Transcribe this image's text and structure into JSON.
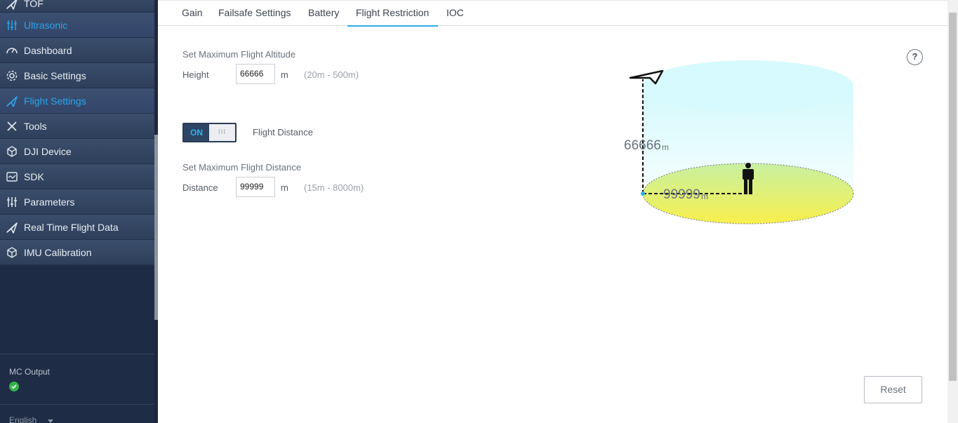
{
  "sidebar": {
    "items": [
      {
        "label": "TOF",
        "icon": "plane-icon",
        "active": false
      },
      {
        "label": "Ultrasonic",
        "icon": "sliders-icon",
        "active": true
      },
      {
        "label": "Dashboard",
        "icon": "gauge-icon",
        "active": false
      },
      {
        "label": "Basic Settings",
        "icon": "gear-icon",
        "active": false
      },
      {
        "label": "Flight Settings",
        "icon": "plane-icon",
        "active": true
      },
      {
        "label": "Tools",
        "icon": "tools-icon",
        "active": false
      },
      {
        "label": "DJI Device",
        "icon": "cube-icon",
        "active": false
      },
      {
        "label": "SDK",
        "icon": "chip-icon",
        "active": false
      },
      {
        "label": "Parameters",
        "icon": "sliders-icon",
        "active": false
      },
      {
        "label": "Real Time Flight Data",
        "icon": "plane-icon",
        "active": false
      },
      {
        "label": "IMU Calibration",
        "icon": "cube-icon",
        "active": false
      }
    ],
    "mc_output_label": "MC Output",
    "mc_status": "ok",
    "language": "English"
  },
  "tabs": [
    {
      "label": "Gain"
    },
    {
      "label": "Failsafe Settings"
    },
    {
      "label": "Battery"
    },
    {
      "label": "Flight Restriction",
      "active": true
    },
    {
      "label": "IOC"
    }
  ],
  "altitude": {
    "section_label": "Set Maximum Flight Altitude",
    "field_label": "Height",
    "value": "66666",
    "unit": "m",
    "range": "(20m - 500m)"
  },
  "distance_toggle": {
    "state_label": "ON",
    "knob_label": "III",
    "label": "Flight Distance"
  },
  "distance": {
    "section_label": "Set Maximum Flight Distance",
    "field_label": "Distance",
    "value": "99999",
    "unit": "m",
    "range": "(15m - 8000m)"
  },
  "diagram": {
    "altitude_value": "66666",
    "altitude_unit": "m",
    "distance_value": "99999",
    "distance_unit": "m"
  },
  "help_label": "?",
  "reset_label": "Reset",
  "colors": {
    "accent": "#27aee4",
    "sidebar_bg": "#1f2c46",
    "status_ok": "#34b34a"
  }
}
